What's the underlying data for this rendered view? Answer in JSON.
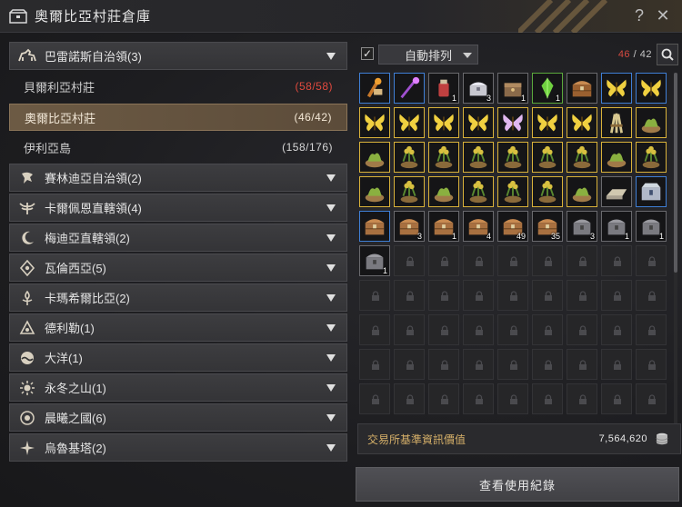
{
  "window": {
    "title": "奧爾比亞村莊倉庫",
    "help": "?",
    "close": "✕"
  },
  "regions": [
    {
      "label": "巴雷諾斯自治領(3)",
      "icon": "horse-icon",
      "expanded": true
    },
    {
      "label": "賽林迪亞自治領(2)",
      "icon": "eagle-icon"
    },
    {
      "label": "卡爾佩恩直轄領(4)",
      "icon": "winged-crest-icon"
    },
    {
      "label": "梅迪亞直轄領(2)",
      "icon": "crescent-moon-icon"
    },
    {
      "label": "瓦倫西亞(5)",
      "icon": "diamond-eye-icon"
    },
    {
      "label": "卡瑪希爾比亞(2)",
      "icon": "flame-tree-icon"
    },
    {
      "label": "德利勒(1)",
      "icon": "triangle-symbol-icon"
    },
    {
      "label": "大洋(1)",
      "icon": "wave-globe-icon"
    },
    {
      "label": "永冬之山(1)",
      "icon": "snow-sun-icon"
    },
    {
      "label": "晨曦之國(6)",
      "icon": "sunrise-flower-icon"
    },
    {
      "label": "烏魯基塔(2)",
      "icon": "star-compass-icon"
    }
  ],
  "towns": [
    {
      "label": "貝爾利亞村莊",
      "count": "(58/58)",
      "full": true
    },
    {
      "label": "奧爾比亞村莊",
      "count": "(46/42)",
      "selected": true
    },
    {
      "label": "伊利亞島",
      "count": "(158/176)"
    }
  ],
  "toolbar": {
    "auto_sort_checked": "✓",
    "auto_sort_label": "自動排列",
    "capacity_used": "46",
    "capacity_sep": "/ ",
    "capacity_max": "42"
  },
  "items": [
    {
      "icon": "torch-scroll-icon",
      "rarity": "blue",
      "color": "#c8782a"
    },
    {
      "icon": "staff-icon",
      "rarity": "blue",
      "color": "#a050d0"
    },
    {
      "icon": "potion-jar-icon",
      "rarity": "grey",
      "color": "#c04040",
      "qty": "1"
    },
    {
      "icon": "silver-chest-icon",
      "rarity": "grey",
      "color": "#c8c8d0",
      "qty": "3"
    },
    {
      "icon": "treasure-box-icon",
      "rarity": "grey",
      "color": "#8a6a4a",
      "qty": "1"
    },
    {
      "icon": "green-crystal-icon",
      "rarity": "green",
      "color": "#70d040",
      "qty": "1"
    },
    {
      "icon": "wooden-chest-icon",
      "rarity": "grey",
      "color": "#9a6030"
    },
    {
      "icon": "butterfly-icon",
      "rarity": "blue",
      "color": "#f0d040"
    },
    {
      "icon": "butterfly-icon",
      "rarity": "blue",
      "color": "#f0d040"
    },
    {
      "icon": "butterfly-icon",
      "rarity": "gold",
      "color": "#f0d040"
    },
    {
      "icon": "butterfly-icon",
      "rarity": "gold",
      "color": "#f0d040"
    },
    {
      "icon": "butterfly-icon",
      "rarity": "gold",
      "color": "#f0d040"
    },
    {
      "icon": "butterfly-icon",
      "rarity": "gold",
      "color": "#f0d040"
    },
    {
      "icon": "butterfly-icon",
      "rarity": "gold",
      "color": "#e0b8f0"
    },
    {
      "icon": "butterfly-icon",
      "rarity": "gold",
      "color": "#f0d040"
    },
    {
      "icon": "butterfly-icon",
      "rarity": "gold",
      "color": "#f0d040"
    },
    {
      "icon": "wheat-bundle-icon",
      "rarity": "gold",
      "color": "#d8c890"
    },
    {
      "icon": "herb-bowl-icon",
      "rarity": "gold",
      "color": "#8ab040"
    },
    {
      "icon": "herb-bowl-icon",
      "rarity": "gold",
      "color": "#8ab040"
    },
    {
      "icon": "flower-pot-icon",
      "rarity": "gold",
      "color": "#d8c040"
    },
    {
      "icon": "flower-pot-icon",
      "rarity": "gold",
      "color": "#d8c040"
    },
    {
      "icon": "flower-pot-icon",
      "rarity": "gold",
      "color": "#d8c040"
    },
    {
      "icon": "flower-pot-icon",
      "rarity": "gold",
      "color": "#d8c040"
    },
    {
      "icon": "flower-pot-icon",
      "rarity": "gold",
      "color": "#d8c040"
    },
    {
      "icon": "flower-pot-icon",
      "rarity": "gold",
      "color": "#d8c040"
    },
    {
      "icon": "herb-bowl-icon",
      "rarity": "gold",
      "color": "#8ab040"
    },
    {
      "icon": "flower-pot-icon",
      "rarity": "gold",
      "color": "#d8c040"
    },
    {
      "icon": "herb-bowl-icon",
      "rarity": "gold",
      "color": "#8ab040"
    },
    {
      "icon": "flower-pot-icon",
      "rarity": "gold",
      "color": "#d8c040"
    },
    {
      "icon": "herb-bowl-icon",
      "rarity": "gold",
      "color": "#8ab040"
    },
    {
      "icon": "flower-pot-icon",
      "rarity": "gold",
      "color": "#d8c040"
    },
    {
      "icon": "flower-pot-icon",
      "rarity": "gold",
      "color": "#d8c040"
    },
    {
      "icon": "flower-pot-icon",
      "rarity": "gold",
      "color": "#d8c040"
    },
    {
      "icon": "herb-bowl-icon",
      "rarity": "gold",
      "color": "#8ab040"
    },
    {
      "icon": "silver-ingot-icon",
      "rarity": "grey",
      "color": "#d0c8b0"
    },
    {
      "icon": "steel-chest-icon",
      "rarity": "blue",
      "color": "#b0b8c8"
    },
    {
      "icon": "wooden-chest-icon",
      "rarity": "blue",
      "color": "#a87040"
    },
    {
      "icon": "wooden-chest-icon",
      "rarity": "grey",
      "color": "#a87040",
      "qty": "3"
    },
    {
      "icon": "wooden-chest-icon",
      "rarity": "grey",
      "color": "#a87040",
      "qty": "1"
    },
    {
      "icon": "wooden-chest-icon",
      "rarity": "grey",
      "color": "#a87040",
      "qty": "4"
    },
    {
      "icon": "wooden-chest-icon",
      "rarity": "grey",
      "color": "#a87040",
      "qty": "49"
    },
    {
      "icon": "wooden-chest-icon",
      "rarity": "grey",
      "color": "#a87040",
      "qty": "35"
    },
    {
      "icon": "locked-chest-icon",
      "rarity": "grey",
      "color": "#7a7a80",
      "qty": "3"
    },
    {
      "icon": "locked-chest-icon",
      "rarity": "grey",
      "color": "#7a7a80",
      "qty": "1"
    },
    {
      "icon": "locked-chest-icon",
      "rarity": "grey",
      "color": "#7a7a80",
      "qty": "1"
    },
    {
      "icon": "locked-chest-icon",
      "rarity": "grey",
      "color": "#7a7a80",
      "qty": "1"
    }
  ],
  "total_slots": 90,
  "value_bar": {
    "label": "交易所基準資訊價值",
    "value": "7,564,620"
  },
  "log_button": "查看使用紀錄"
}
